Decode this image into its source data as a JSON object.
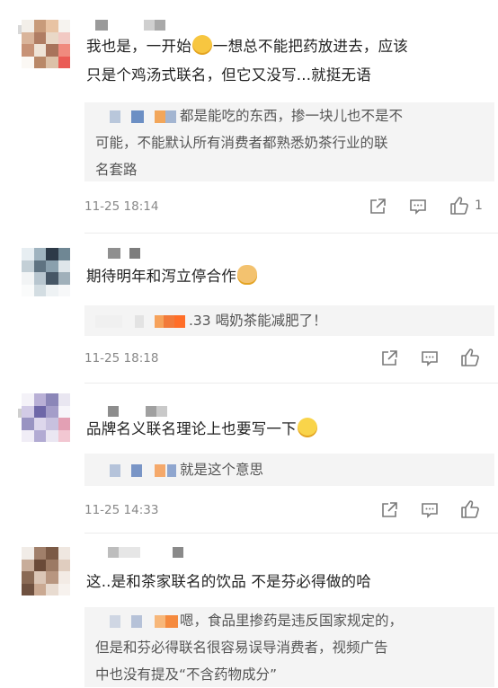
{
  "comments": [
    {
      "text_line1_a": "我也是，一开始",
      "text_line1_b": "一想总不能把药放进去，应该",
      "text_line2": "只是个鸡汤式联名，但它又没写...就挺无语",
      "reply": {
        "line1": "都是能吃的东西，掺一块儿也不是不",
        "line2": "可能，不能默认所有消费者都熟悉奶茶行业的联",
        "line3": "名套路"
      },
      "time": "11-25 18:14",
      "like_count": "1"
    },
    {
      "text": "期待明年和泻立停合作",
      "reply": {
        "line1": ".33 喝奶茶能减肥了！"
      },
      "time": "11-25 18:18"
    },
    {
      "text": "品牌名义联名理论上也要写一下",
      "reply": {
        "line1": "就是这个意思"
      },
      "time": "11-25 14:33"
    },
    {
      "text": "这..是和茶家联名的饮品 不是芬必得做的哈",
      "reply": {
        "line1": "嗯，食品里掺药是违反国家规定的，",
        "line2": "但是和芬必得联名很容易误导消费者，视频广告",
        "line3": "中也没有提及“不含药物成分”"
      }
    }
  ],
  "icons": {
    "share": "share-icon",
    "comment": "comment-icon",
    "like": "thumbs-up-icon",
    "emoji_sweat": "sweat-smile-emoji",
    "emoji_dog": "doge-emoji",
    "emoji_smile": "smile-emoji"
  },
  "colors": {
    "reply_bg": "#f4f4f4",
    "text": "#222222",
    "meta": "#888888",
    "icon": "#7a7a7a"
  }
}
